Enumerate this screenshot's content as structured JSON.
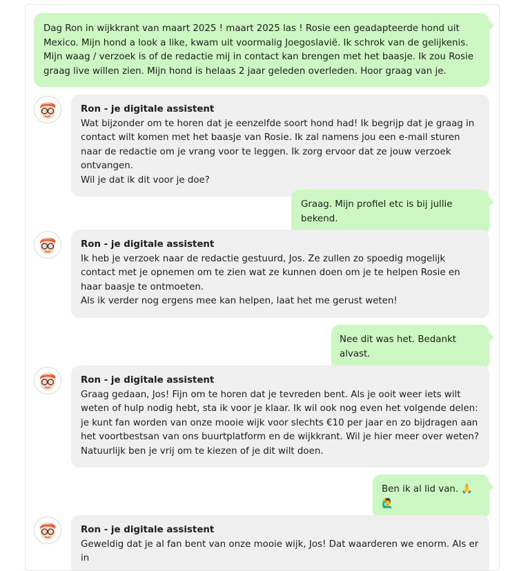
{
  "messages": [
    {
      "role": "user",
      "text": "Dag Ron in wijkkrant van maart 2025 ! maart 2025 las ! Rosie een geadapteerde hond uit Mexico. Mijn hond a look a like, kwam uit voormalig Joegoslavië. Ik schrok van de gelijkenis. Mijn waag / verzoek is of de redactie mij in contact kan brengen met het baasje. Ik zou Rosie graag live willen zien. Mijn hond is helaas 2 jaar geleden overleden. Hoor graag van je."
    },
    {
      "role": "bot",
      "name": "Ron - je digitale assistent",
      "text": "Wat bijzonder om te horen dat je eenzelfde soort hond had! Ik begrijp dat je graag in contact wilt komen met het baasje van Rosie. Ik zal namens jou een e-mail sturen naar de redactie om je vrang voor te leggen. Ik zorg ervoor dat ze jouw verzoek ontvangen.\nWil je dat ik dit voor je doe?"
    },
    {
      "role": "user",
      "text": "Graag. Mijn profiel etc is bij jullie bekend."
    },
    {
      "role": "bot",
      "name": "Ron - je digitale assistent",
      "text": "Ik heb je verzoek naar de redactie gestuurd, Jos. Ze zullen zo spoedig mogelijk contact met je opnemen om te zien wat ze kunnen doen om je te helpen Rosie en haar baasje te ontmoeten.\nAls ik verder nog ergens mee kan helpen, laat het me gerust weten!"
    },
    {
      "role": "user",
      "text": "Nee dit was het. Bedankt alvast."
    },
    {
      "role": "bot",
      "name": "Ron - je digitale assistent",
      "text": "Graag gedaan, Jos! Fijn om te horen dat je tevreden bent. Als je ooit weer iets wilt weten of hulp nodig hebt, sta ik voor je klaar. Ik wil ook nog even het volgende delen: je kunt fan worden van onze mooie wijk voor slechts €10 per jaar en zo bijdragen aan het voortbestsan van ons buurtplatform en de wijkkrant. Wil je hier meer over weten?\nNatuurlijk ben je vrij om te kiezen of je dit wilt doen."
    },
    {
      "role": "user",
      "text": "Ben ik al lid van. 🙏🙋‍♂️"
    },
    {
      "role": "bot",
      "name": "Ron - je digitale assistent",
      "text": "Geweldig dat je al fan bent van onze mooie wijk, Jos! Dat waarderen we enorm. Als er in"
    }
  ]
}
